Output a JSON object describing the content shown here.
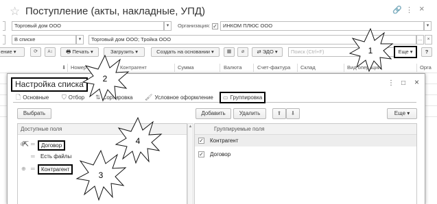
{
  "window": {
    "title": "Поступление (акты, накладные, УПД)",
    "icons": {
      "link": "🔗",
      "more": "⋮",
      "close": "×"
    }
  },
  "filters": {
    "row1": {
      "partner": "Торговый дом ООО",
      "org_label": "Организация:",
      "org_value": "ИНКОМ ПЛЮС ООО"
    },
    "row2": {
      "status": "В списке",
      "contract": "Торговый дом ООО; Тройка ООО"
    }
  },
  "toolbar": {
    "create_label": "ение",
    "print_label": "Печать",
    "load_label": "Загрузить",
    "create_based_label": "Создать на основании",
    "edo_label": "ЭДО",
    "search_placeholder": "Поиск (Ctrl+F)",
    "more_label": "Еще",
    "help_label": "?",
    "sort_icon": "⬇"
  },
  "columns": [
    "Номер",
    "Контрагент",
    "Сумма",
    "Валюта",
    "Счет-фактура",
    "Склад",
    "Вид операции",
    "Орга"
  ],
  "dialog": {
    "title": "Настройка списка",
    "controls": {
      "more": "⋮",
      "maximize": "□",
      "close": "×"
    },
    "tabs": [
      {
        "label": "Основные",
        "icon": "🗋"
      },
      {
        "label": "Отбор",
        "icon": "⛉"
      },
      {
        "label": "Сортировка",
        "icon": "⇅"
      },
      {
        "label": "Условное оформление",
        "icon": "🖌"
      },
      {
        "label": "Группировка",
        "icon": "▭",
        "active": true
      }
    ],
    "left": {
      "select_button": "Выбрать",
      "header": "Доступные поля",
      "fields": [
        {
          "label": "Договор",
          "expander": "⊕",
          "highlighted": true
        },
        {
          "label": "Есть файлы",
          "expander": "",
          "highlighted": false
        },
        {
          "label": "Контрагент",
          "expander": "⊕",
          "highlighted": true
        }
      ]
    },
    "right": {
      "add_button": "Добавить",
      "delete_button": "Удалить",
      "up_button": "⬆",
      "down_button": "⬇",
      "more_button": "Еще",
      "header": "Группируемые поля",
      "rows": [
        {
          "label": "Контрагент",
          "checked": true
        },
        {
          "label": "Договор",
          "checked": true
        }
      ]
    }
  },
  "callouts": [
    "1",
    "2",
    "3",
    "4"
  ],
  "colors": {
    "highlight_border": "#000000",
    "header_bg": "#f2f2f2",
    "selected_row": "#ededed"
  }
}
